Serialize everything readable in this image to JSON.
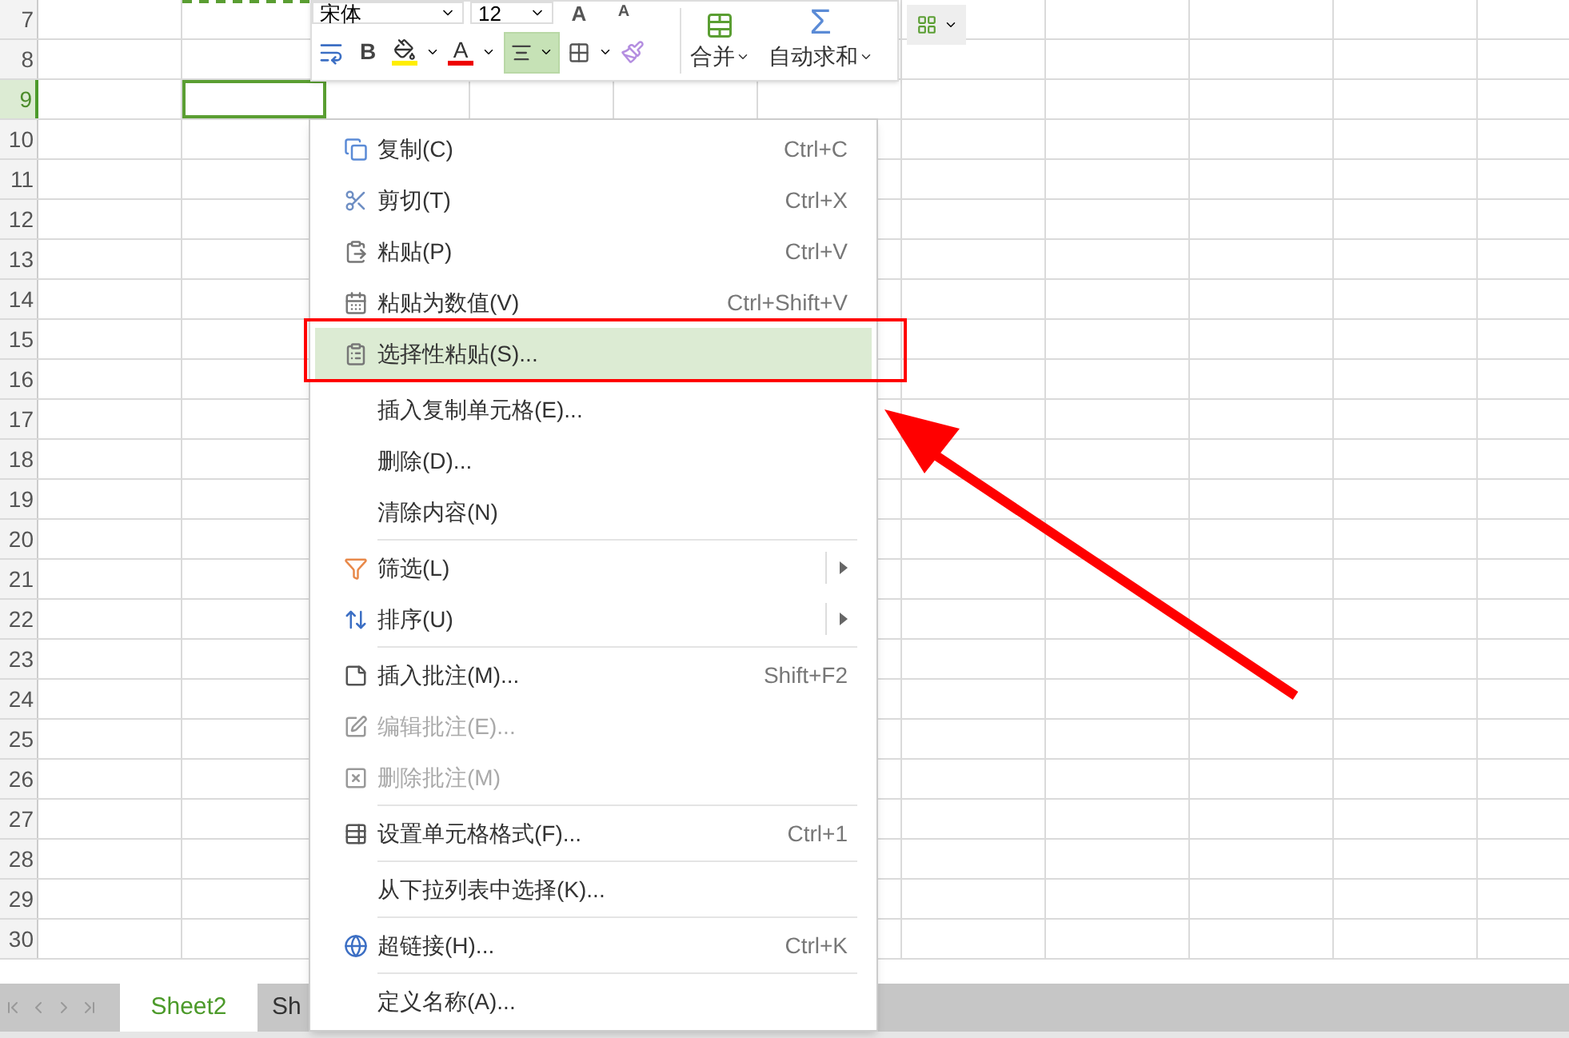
{
  "toolbar": {
    "font": "宋体",
    "size": "12",
    "grow": "A",
    "shrink": "A",
    "bold": "B",
    "font_color": "A",
    "align_selected": true,
    "merge": "合并",
    "autosum": "自动求和",
    "autosum_symbol": "Σ"
  },
  "rows": [
    {
      "label": "7",
      "selected": false
    },
    {
      "label": "8",
      "selected": false
    },
    {
      "label": "9",
      "selected": true
    },
    {
      "label": "10",
      "selected": false
    },
    {
      "label": "11",
      "selected": false
    },
    {
      "label": "12",
      "selected": false
    },
    {
      "label": "13",
      "selected": false
    },
    {
      "label": "14",
      "selected": false
    },
    {
      "label": "15",
      "selected": false
    },
    {
      "label": "16",
      "selected": false
    },
    {
      "label": "17",
      "selected": false
    },
    {
      "label": "18",
      "selected": false
    },
    {
      "label": "19",
      "selected": false
    },
    {
      "label": "20",
      "selected": false
    },
    {
      "label": "21",
      "selected": false
    },
    {
      "label": "22",
      "selected": false
    },
    {
      "label": "23",
      "selected": false
    },
    {
      "label": "24",
      "selected": false
    },
    {
      "label": "25",
      "selected": false
    },
    {
      "label": "26",
      "selected": false
    },
    {
      "label": "27",
      "selected": false
    },
    {
      "label": "28",
      "selected": false
    },
    {
      "label": "29",
      "selected": false
    },
    {
      "label": "30",
      "selected": false
    }
  ],
  "context_menu": [
    {
      "kind": "item",
      "label": "复制(C)",
      "shortcut": "Ctrl+C",
      "disabled": false,
      "selected": false
    },
    {
      "kind": "item",
      "label": "剪切(T)",
      "shortcut": "Ctrl+X",
      "disabled": false,
      "selected": false
    },
    {
      "kind": "item",
      "label": "粘贴(P)",
      "shortcut": "Ctrl+V",
      "disabled": false,
      "selected": false
    },
    {
      "kind": "item",
      "label": "粘贴为数值(V)",
      "shortcut": "Ctrl+Shift+V",
      "disabled": false,
      "selected": false
    },
    {
      "kind": "item",
      "label": "选择性粘贴(S)...",
      "disabled": false,
      "selected": true
    },
    {
      "kind": "separator"
    },
    {
      "kind": "item",
      "label": "插入复制单元格(E)...",
      "disabled": false,
      "selected": false
    },
    {
      "kind": "item",
      "label": "删除(D)...",
      "disabled": false,
      "selected": false
    },
    {
      "kind": "item",
      "label": "清除内容(N)",
      "disabled": false,
      "selected": false
    },
    {
      "kind": "separator"
    },
    {
      "kind": "submenu",
      "label": "筛选(L)",
      "disabled": false,
      "selected": false
    },
    {
      "kind": "submenu",
      "label": "排序(U)",
      "disabled": false,
      "selected": false
    },
    {
      "kind": "separator"
    },
    {
      "kind": "item",
      "label": "插入批注(M)...",
      "shortcut": "Shift+F2",
      "disabled": false,
      "selected": false
    },
    {
      "kind": "item",
      "label": "编辑批注(E)...",
      "disabled": true,
      "selected": false
    },
    {
      "kind": "item",
      "label": "删除批注(M)",
      "disabled": true,
      "selected": false
    },
    {
      "kind": "separator"
    },
    {
      "kind": "item",
      "label": "设置单元格格式(F)...",
      "shortcut": "Ctrl+1",
      "disabled": false,
      "selected": false
    },
    {
      "kind": "separator"
    },
    {
      "kind": "item",
      "label": "从下拉列表中选择(K)...",
      "disabled": false,
      "selected": false
    },
    {
      "kind": "separator"
    },
    {
      "kind": "item",
      "label": "超链接(H)...",
      "shortcut": "Ctrl+K",
      "disabled": false,
      "selected": false
    },
    {
      "kind": "separator"
    },
    {
      "kind": "item",
      "label": "定义名称(A)...",
      "disabled": false,
      "selected": false
    }
  ],
  "sheet_tabs": [
    {
      "label": "Sheet2",
      "selected": true
    },
    {
      "label": "Sh",
      "selected": false
    }
  ]
}
